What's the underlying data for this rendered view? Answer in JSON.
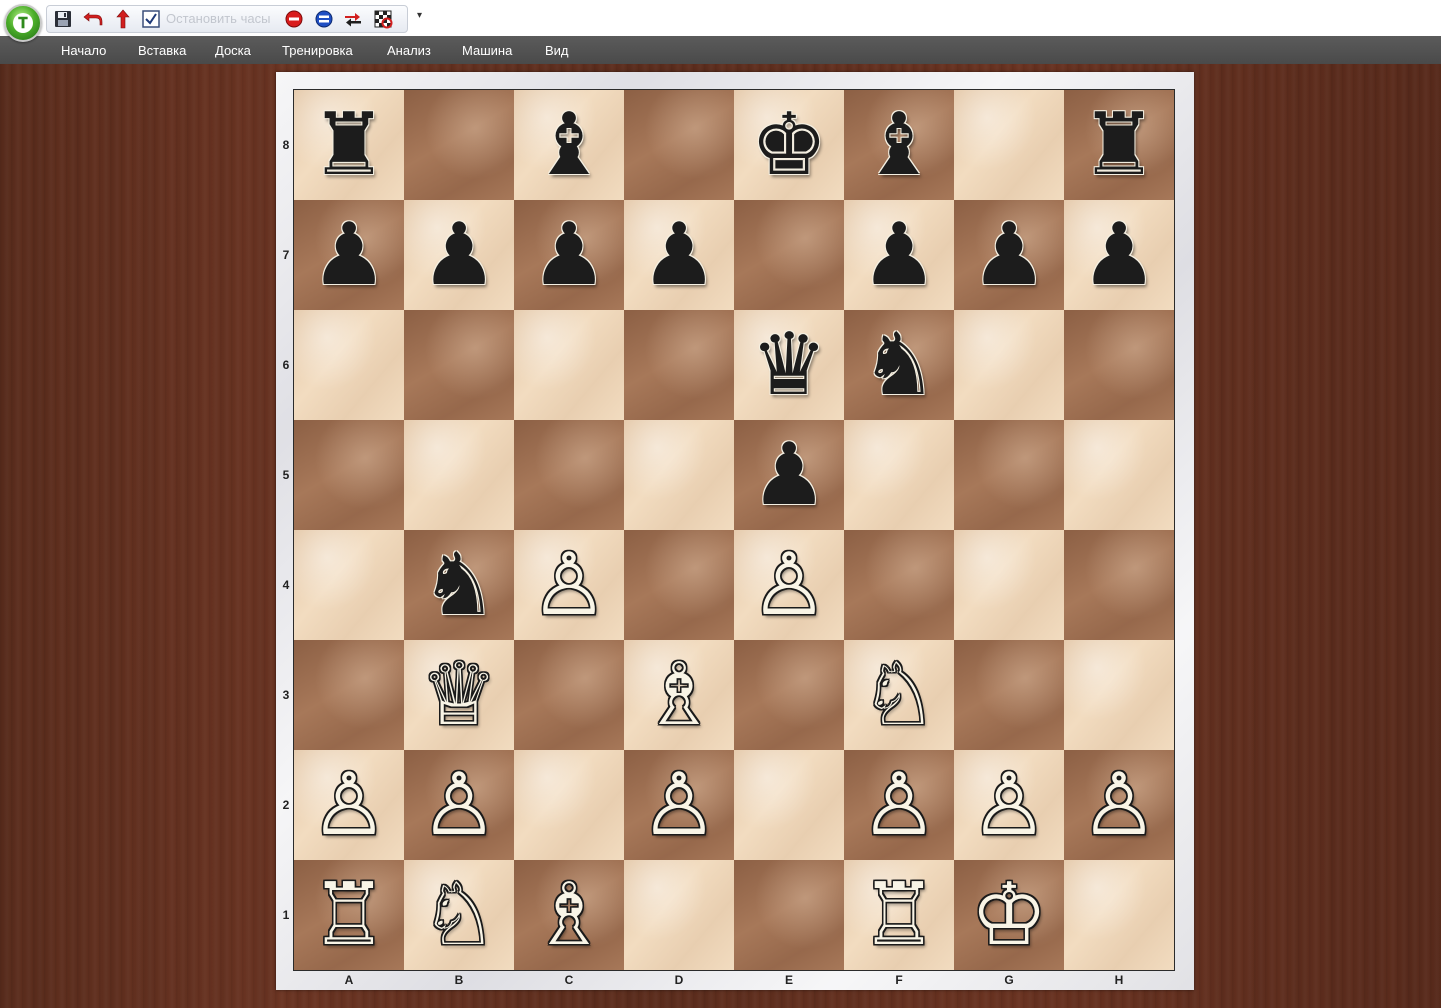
{
  "toolbar": {
    "orb_icon": "app-orb-icon",
    "buttons": [
      {
        "name": "save-button",
        "icon": "floppy-disk-icon"
      },
      {
        "name": "undo-button",
        "icon": "undo-arrow-icon"
      },
      {
        "name": "upload-button",
        "icon": "red-up-arrow-icon"
      },
      {
        "name": "checkbox-button",
        "icon": "checkbox-icon"
      }
    ],
    "clock_label": "Остановить часы",
    "extra_buttons": [
      {
        "name": "stop-button",
        "icon": "red-stop-icon"
      },
      {
        "name": "pause-button",
        "icon": "blue-pause-icon"
      },
      {
        "name": "flip-board-button",
        "icon": "swap-arrows-icon"
      },
      {
        "name": "board-settings-button",
        "icon": "checkered-board-icon"
      }
    ],
    "dropdown_glyph": "▾"
  },
  "menu": {
    "items": [
      "Начало",
      "Вставка",
      "Доска",
      "Тренировка",
      "Анализ",
      "Машина",
      "Вид"
    ]
  },
  "board": {
    "files": [
      "A",
      "B",
      "C",
      "D",
      "E",
      "F",
      "G",
      "H"
    ],
    "ranks": [
      "8",
      "7",
      "6",
      "5",
      "4",
      "3",
      "2",
      "1"
    ],
    "pieces": {
      "a8": {
        "glyph": "♜",
        "color": "black",
        "name": "black-rook-icon"
      },
      "c8": {
        "glyph": "♝",
        "color": "black",
        "name": "black-bishop-icon"
      },
      "e8": {
        "glyph": "♚",
        "color": "black",
        "name": "black-king-icon"
      },
      "f8": {
        "glyph": "♝",
        "color": "black",
        "name": "black-bishop-icon"
      },
      "h8": {
        "glyph": "♜",
        "color": "black",
        "name": "black-rook-icon"
      },
      "a7": {
        "glyph": "♟",
        "color": "black",
        "name": "black-pawn-icon"
      },
      "b7": {
        "glyph": "♟",
        "color": "black",
        "name": "black-pawn-icon"
      },
      "c7": {
        "glyph": "♟",
        "color": "black",
        "name": "black-pawn-icon"
      },
      "d7": {
        "glyph": "♟",
        "color": "black",
        "name": "black-pawn-icon"
      },
      "f7": {
        "glyph": "♟",
        "color": "black",
        "name": "black-pawn-icon"
      },
      "g7": {
        "glyph": "♟",
        "color": "black",
        "name": "black-pawn-icon"
      },
      "h7": {
        "glyph": "♟",
        "color": "black",
        "name": "black-pawn-icon"
      },
      "e6": {
        "glyph": "♛",
        "color": "black",
        "name": "black-queen-icon"
      },
      "f6": {
        "glyph": "♞",
        "color": "black",
        "name": "black-knight-icon"
      },
      "e5": {
        "glyph": "♟",
        "color": "black",
        "name": "black-pawn-icon"
      },
      "b4": {
        "glyph": "♞",
        "color": "black",
        "name": "black-knight-icon"
      },
      "c4": {
        "glyph": "♙",
        "color": "white",
        "name": "white-pawn-icon"
      },
      "e4": {
        "glyph": "♙",
        "color": "white",
        "name": "white-pawn-icon"
      },
      "b3": {
        "glyph": "♕",
        "color": "white",
        "name": "white-queen-icon"
      },
      "d3": {
        "glyph": "♗",
        "color": "white",
        "name": "white-bishop-icon"
      },
      "f3": {
        "glyph": "♘",
        "color": "white",
        "name": "white-knight-icon"
      },
      "a2": {
        "glyph": "♙",
        "color": "white",
        "name": "white-pawn-icon"
      },
      "b2": {
        "glyph": "♙",
        "color": "white",
        "name": "white-pawn-icon"
      },
      "d2": {
        "glyph": "♙",
        "color": "white",
        "name": "white-pawn-icon"
      },
      "f2": {
        "glyph": "♙",
        "color": "white",
        "name": "white-pawn-icon"
      },
      "g2": {
        "glyph": "♙",
        "color": "white",
        "name": "white-pawn-icon"
      },
      "h2": {
        "glyph": "♙",
        "color": "white",
        "name": "white-pawn-icon"
      },
      "a1": {
        "glyph": "♖",
        "color": "white",
        "name": "white-rook-icon"
      },
      "b1": {
        "glyph": "♘",
        "color": "white",
        "name": "white-knight-icon"
      },
      "c1": {
        "glyph": "♗",
        "color": "white",
        "name": "white-bishop-icon"
      },
      "f1": {
        "glyph": "♖",
        "color": "white",
        "name": "white-rook-icon"
      },
      "g1": {
        "glyph": "♔",
        "color": "white",
        "name": "white-king-icon"
      }
    }
  },
  "colors": {
    "menubar": "#4e4e4e",
    "light_square": "#f2dcc0",
    "dark_square": "#a77859",
    "frame": "#ececef",
    "background_wood": "#5e2e1e"
  }
}
